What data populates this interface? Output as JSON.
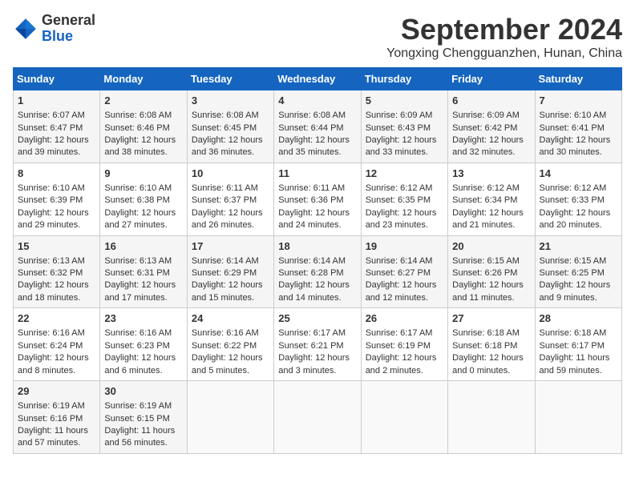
{
  "header": {
    "logo_general": "General",
    "logo_blue": "Blue",
    "month_title": "September 2024",
    "location": "Yongxing Chengguanzhen, Hunan, China"
  },
  "weekdays": [
    "Sunday",
    "Monday",
    "Tuesday",
    "Wednesday",
    "Thursday",
    "Friday",
    "Saturday"
  ],
  "weeks": [
    [
      {
        "day": "1",
        "lines": [
          "Sunrise: 6:07 AM",
          "Sunset: 6:47 PM",
          "Daylight: 12 hours",
          "and 39 minutes."
        ]
      },
      {
        "day": "2",
        "lines": [
          "Sunrise: 6:08 AM",
          "Sunset: 6:46 PM",
          "Daylight: 12 hours",
          "and 38 minutes."
        ]
      },
      {
        "day": "3",
        "lines": [
          "Sunrise: 6:08 AM",
          "Sunset: 6:45 PM",
          "Daylight: 12 hours",
          "and 36 minutes."
        ]
      },
      {
        "day": "4",
        "lines": [
          "Sunrise: 6:08 AM",
          "Sunset: 6:44 PM",
          "Daylight: 12 hours",
          "and 35 minutes."
        ]
      },
      {
        "day": "5",
        "lines": [
          "Sunrise: 6:09 AM",
          "Sunset: 6:43 PM",
          "Daylight: 12 hours",
          "and 33 minutes."
        ]
      },
      {
        "day": "6",
        "lines": [
          "Sunrise: 6:09 AM",
          "Sunset: 6:42 PM",
          "Daylight: 12 hours",
          "and 32 minutes."
        ]
      },
      {
        "day": "7",
        "lines": [
          "Sunrise: 6:10 AM",
          "Sunset: 6:41 PM",
          "Daylight: 12 hours",
          "and 30 minutes."
        ]
      }
    ],
    [
      {
        "day": "8",
        "lines": [
          "Sunrise: 6:10 AM",
          "Sunset: 6:39 PM",
          "Daylight: 12 hours",
          "and 29 minutes."
        ]
      },
      {
        "day": "9",
        "lines": [
          "Sunrise: 6:10 AM",
          "Sunset: 6:38 PM",
          "Daylight: 12 hours",
          "and 27 minutes."
        ]
      },
      {
        "day": "10",
        "lines": [
          "Sunrise: 6:11 AM",
          "Sunset: 6:37 PM",
          "Daylight: 12 hours",
          "and 26 minutes."
        ]
      },
      {
        "day": "11",
        "lines": [
          "Sunrise: 6:11 AM",
          "Sunset: 6:36 PM",
          "Daylight: 12 hours",
          "and 24 minutes."
        ]
      },
      {
        "day": "12",
        "lines": [
          "Sunrise: 6:12 AM",
          "Sunset: 6:35 PM",
          "Daylight: 12 hours",
          "and 23 minutes."
        ]
      },
      {
        "day": "13",
        "lines": [
          "Sunrise: 6:12 AM",
          "Sunset: 6:34 PM",
          "Daylight: 12 hours",
          "and 21 minutes."
        ]
      },
      {
        "day": "14",
        "lines": [
          "Sunrise: 6:12 AM",
          "Sunset: 6:33 PM",
          "Daylight: 12 hours",
          "and 20 minutes."
        ]
      }
    ],
    [
      {
        "day": "15",
        "lines": [
          "Sunrise: 6:13 AM",
          "Sunset: 6:32 PM",
          "Daylight: 12 hours",
          "and 18 minutes."
        ]
      },
      {
        "day": "16",
        "lines": [
          "Sunrise: 6:13 AM",
          "Sunset: 6:31 PM",
          "Daylight: 12 hours",
          "and 17 minutes."
        ]
      },
      {
        "day": "17",
        "lines": [
          "Sunrise: 6:14 AM",
          "Sunset: 6:29 PM",
          "Daylight: 12 hours",
          "and 15 minutes."
        ]
      },
      {
        "day": "18",
        "lines": [
          "Sunrise: 6:14 AM",
          "Sunset: 6:28 PM",
          "Daylight: 12 hours",
          "and 14 minutes."
        ]
      },
      {
        "day": "19",
        "lines": [
          "Sunrise: 6:14 AM",
          "Sunset: 6:27 PM",
          "Daylight: 12 hours",
          "and 12 minutes."
        ]
      },
      {
        "day": "20",
        "lines": [
          "Sunrise: 6:15 AM",
          "Sunset: 6:26 PM",
          "Daylight: 12 hours",
          "and 11 minutes."
        ]
      },
      {
        "day": "21",
        "lines": [
          "Sunrise: 6:15 AM",
          "Sunset: 6:25 PM",
          "Daylight: 12 hours",
          "and 9 minutes."
        ]
      }
    ],
    [
      {
        "day": "22",
        "lines": [
          "Sunrise: 6:16 AM",
          "Sunset: 6:24 PM",
          "Daylight: 12 hours",
          "and 8 minutes."
        ]
      },
      {
        "day": "23",
        "lines": [
          "Sunrise: 6:16 AM",
          "Sunset: 6:23 PM",
          "Daylight: 12 hours",
          "and 6 minutes."
        ]
      },
      {
        "day": "24",
        "lines": [
          "Sunrise: 6:16 AM",
          "Sunset: 6:22 PM",
          "Daylight: 12 hours",
          "and 5 minutes."
        ]
      },
      {
        "day": "25",
        "lines": [
          "Sunrise: 6:17 AM",
          "Sunset: 6:21 PM",
          "Daylight: 12 hours",
          "and 3 minutes."
        ]
      },
      {
        "day": "26",
        "lines": [
          "Sunrise: 6:17 AM",
          "Sunset: 6:19 PM",
          "Daylight: 12 hours",
          "and 2 minutes."
        ]
      },
      {
        "day": "27",
        "lines": [
          "Sunrise: 6:18 AM",
          "Sunset: 6:18 PM",
          "Daylight: 12 hours",
          "and 0 minutes."
        ]
      },
      {
        "day": "28",
        "lines": [
          "Sunrise: 6:18 AM",
          "Sunset: 6:17 PM",
          "Daylight: 11 hours",
          "and 59 minutes."
        ]
      }
    ],
    [
      {
        "day": "29",
        "lines": [
          "Sunrise: 6:19 AM",
          "Sunset: 6:16 PM",
          "Daylight: 11 hours",
          "and 57 minutes."
        ]
      },
      {
        "day": "30",
        "lines": [
          "Sunrise: 6:19 AM",
          "Sunset: 6:15 PM",
          "Daylight: 11 hours",
          "and 56 minutes."
        ]
      },
      {
        "day": "",
        "lines": []
      },
      {
        "day": "",
        "lines": []
      },
      {
        "day": "",
        "lines": []
      },
      {
        "day": "",
        "lines": []
      },
      {
        "day": "",
        "lines": []
      }
    ]
  ]
}
